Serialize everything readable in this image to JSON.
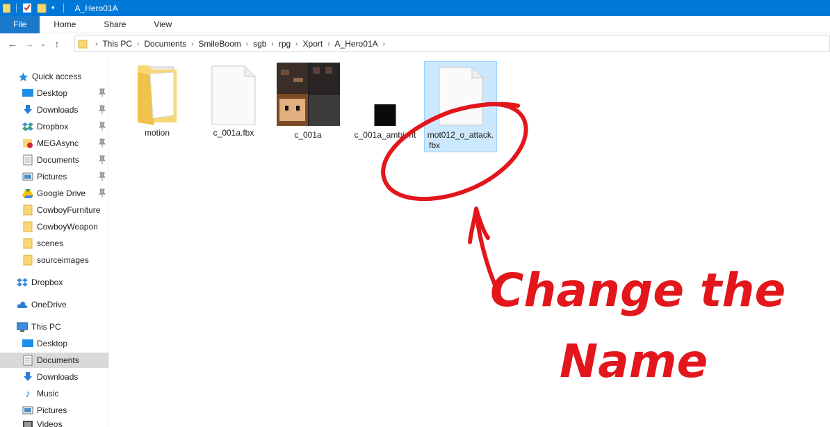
{
  "window": {
    "title": "A_Hero01A"
  },
  "ribbon": {
    "tabs": [
      "File",
      "Home",
      "Share",
      "View"
    ]
  },
  "address": {
    "crumbs": [
      "This PC",
      "Documents",
      "SmileBoom",
      "sgb",
      "rpg",
      "Xport",
      "A_Hero01A"
    ]
  },
  "sidebar": {
    "quick_access": "Quick access",
    "qa_items": [
      "Desktop",
      "Downloads",
      "Dropbox",
      "MEGAsync",
      "Documents",
      "Pictures",
      "Google Drive",
      "CowboyFurniture",
      "CowboyWeapon",
      "scenes",
      "sourceimages"
    ],
    "dropbox": "Dropbox",
    "onedrive": "OneDrive",
    "this_pc": "This PC",
    "pc_items": [
      "Desktop",
      "Documents",
      "Downloads",
      "Music",
      "Pictures",
      "Videos"
    ]
  },
  "files": [
    {
      "name": "motion",
      "type": "folder"
    },
    {
      "name": "c_001a.fbx",
      "type": "document"
    },
    {
      "name": "c_001a",
      "type": "texture"
    },
    {
      "name": "c_001a_ambient",
      "type": "black-image"
    },
    {
      "name_line1": "mot012_o_attack.",
      "name_line2": "fbx",
      "type": "document",
      "selected": true
    }
  ],
  "annotation": {
    "line1": "Change the",
    "line2": "Name",
    "color": "#e2161b"
  },
  "colors": {
    "titlebar": "#0078d7",
    "file_tab": "#1979ca",
    "selection": "#cce8ff",
    "folder": "#f8d775"
  }
}
